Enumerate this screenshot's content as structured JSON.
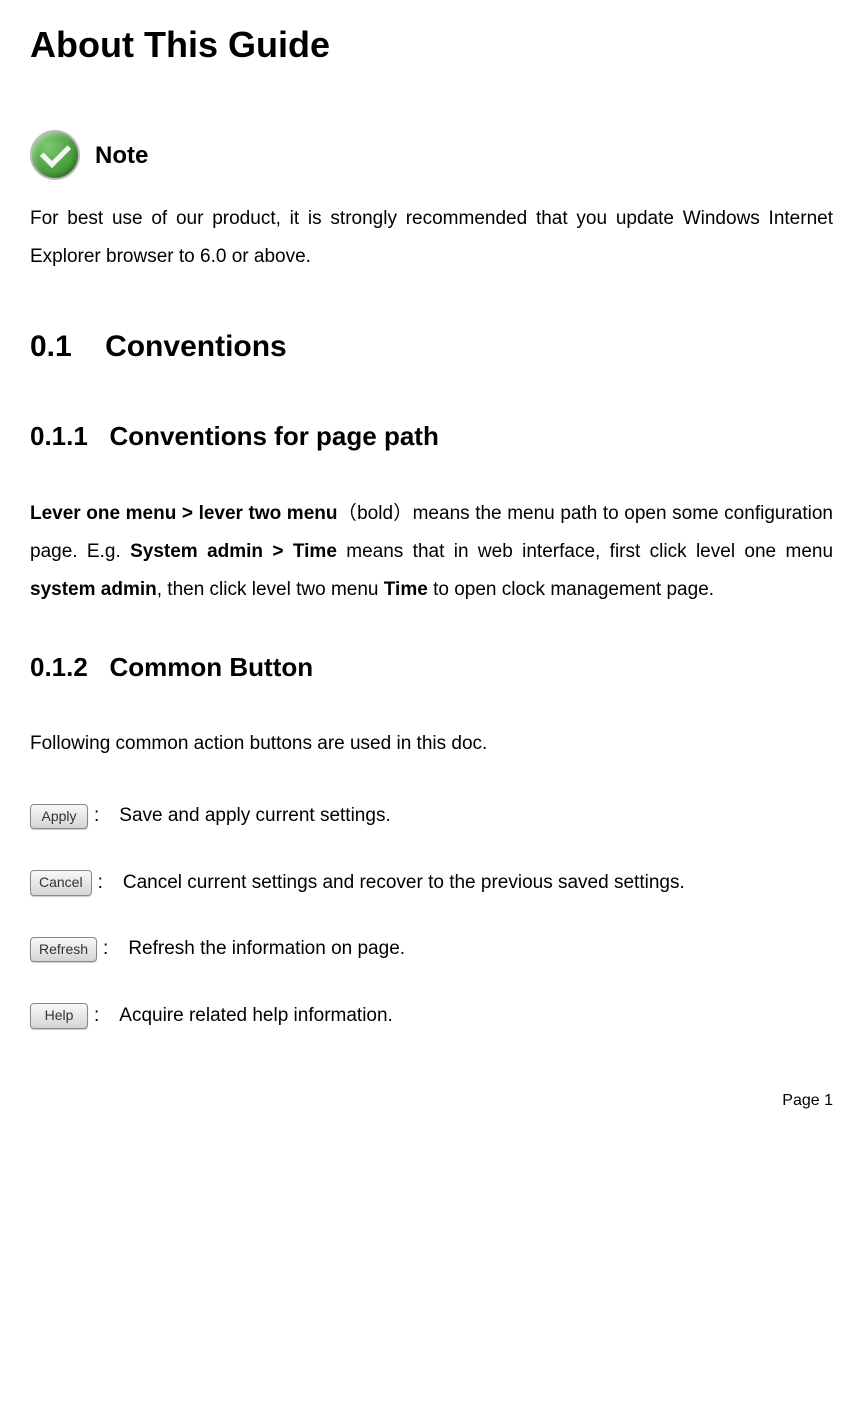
{
  "title": "About This Guide",
  "note": {
    "label": "Note",
    "text": "For best use of our product, it is strongly recommended that you update Windows Internet Explorer browser to 6.0 or above."
  },
  "section01": {
    "number": "0.1",
    "title": "Conventions"
  },
  "section011": {
    "number": "0.1.1",
    "title": "Conventions for page path",
    "para_part1_bold": "Lever one menu > lever two menu",
    "para_part2": "（bold）means the menu path to open some configuration page. E.g. ",
    "para_part3_bold": "System admin > Time",
    "para_part4": " means that in web interface, first click level one menu ",
    "para_part5_bold": "system admin",
    "para_part6": ", then click level two menu ",
    "para_part7_bold": "Time",
    "para_part8": " to open clock management page."
  },
  "section012": {
    "number": "0.1.2",
    "title": "Common Button",
    "intro": "Following common action buttons are used in this doc.",
    "buttons": [
      {
        "label": "Apply",
        "desc": "Save and apply current settings."
      },
      {
        "label": "Cancel",
        "desc": "Cancel current settings and recover to the previous saved settings."
      },
      {
        "label": "Refresh",
        "desc": "Refresh the information on page."
      },
      {
        "label": "Help",
        "desc": "Acquire related help information."
      }
    ]
  },
  "footer": {
    "page_label": "Page",
    "page_num": "1"
  }
}
